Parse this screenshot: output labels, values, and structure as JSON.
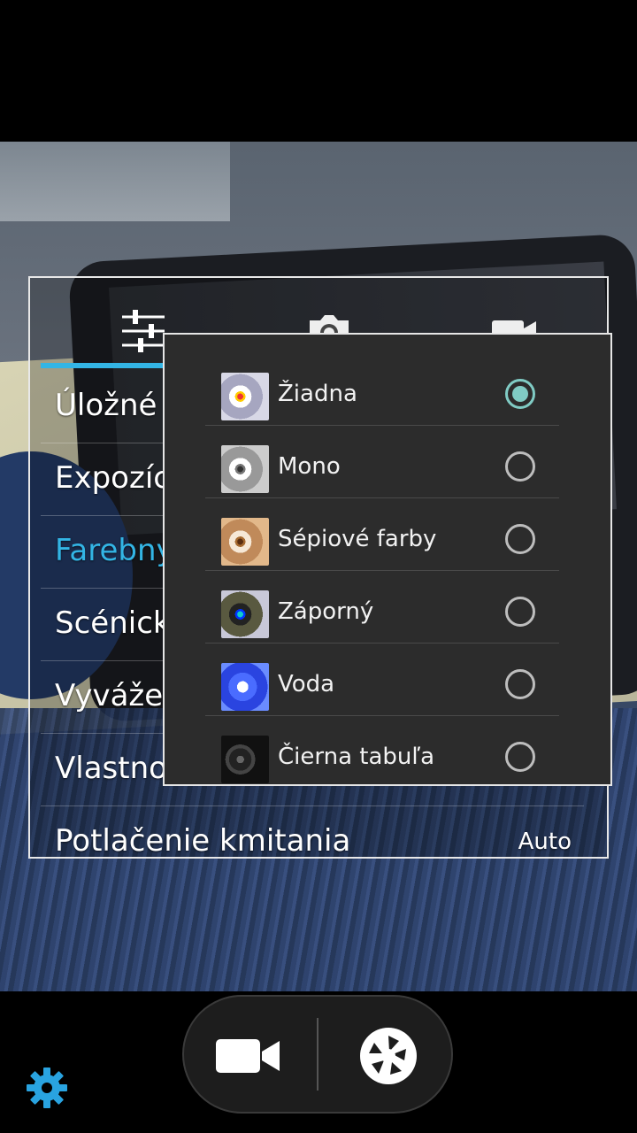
{
  "colors": {
    "accent": "#33b5e5",
    "radio_selected": "#80cbc4",
    "gear": "#29a3e0"
  },
  "settings_panel": {
    "tabs": [
      {
        "icon": "sliders-icon",
        "selected": true
      },
      {
        "icon": "camera-icon",
        "selected": false
      },
      {
        "icon": "video-camera-icon",
        "selected": false
      }
    ],
    "items": [
      {
        "label": "Úložné m",
        "value": ""
      },
      {
        "label": "Expozíc",
        "value": ""
      },
      {
        "label": "Farebný",
        "value": "",
        "active": true
      },
      {
        "label": "Scénick",
        "value": ""
      },
      {
        "label": "Vyvážen",
        "value": ""
      },
      {
        "label": "Vlastno",
        "value": ""
      },
      {
        "label": "Potlačenie kmitania",
        "value": "Auto"
      }
    ]
  },
  "color_effect_popup": {
    "options": [
      {
        "label": "Žiadna",
        "thumb": "color-none",
        "checked": true
      },
      {
        "label": "Mono",
        "thumb": "mono",
        "checked": false
      },
      {
        "label": "Sépiové farby",
        "thumb": "sepia",
        "checked": false
      },
      {
        "label": "Záporný",
        "thumb": "negative",
        "checked": false
      },
      {
        "label": "Voda",
        "thumb": "aqua",
        "checked": false
      },
      {
        "label": "Čierna tabuľa",
        "thumb": "blackboard",
        "checked": false
      }
    ]
  },
  "bottom_bar": {
    "video_icon": "video-camera-icon",
    "shutter_icon": "shutter-icon",
    "settings_icon": "gear-icon"
  }
}
